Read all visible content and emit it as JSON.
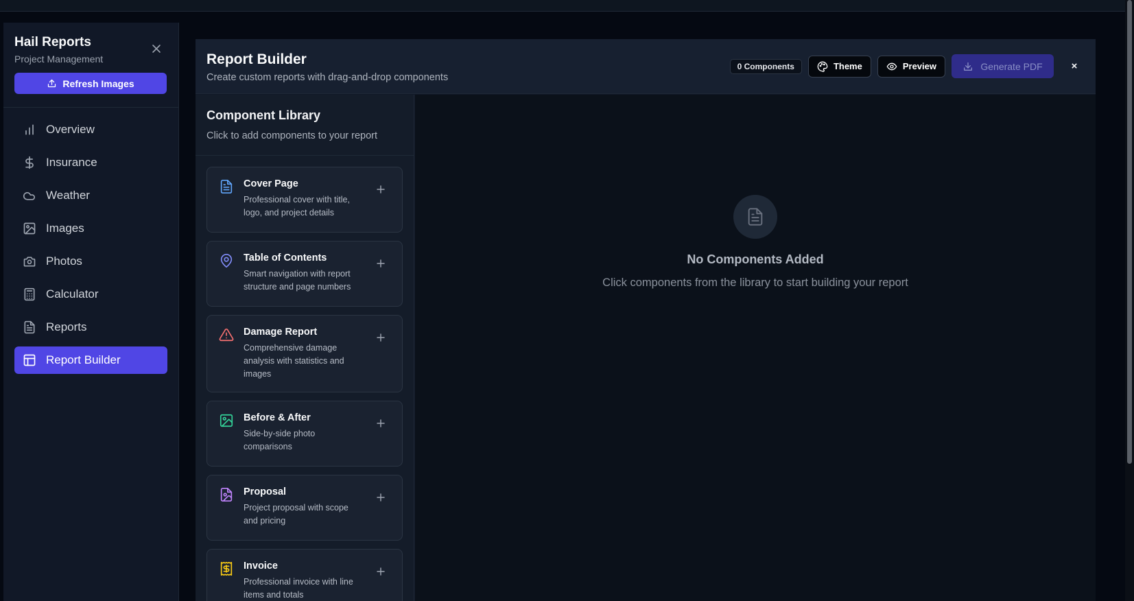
{
  "sidebar": {
    "title": "Hail Reports",
    "subtitle": "Project Management",
    "refresh_label": "Refresh Images",
    "items": [
      {
        "label": "Overview",
        "icon": "bar-chart-icon"
      },
      {
        "label": "Insurance",
        "icon": "dollar-icon"
      },
      {
        "label": "Weather",
        "icon": "cloud-icon"
      },
      {
        "label": "Images",
        "icon": "image-icon"
      },
      {
        "label": "Photos",
        "icon": "camera-icon"
      },
      {
        "label": "Calculator",
        "icon": "calculator-icon"
      },
      {
        "label": "Reports",
        "icon": "file-text-icon"
      },
      {
        "label": "Report Builder",
        "icon": "layout-icon",
        "active": true
      }
    ]
  },
  "header": {
    "title": "Report Builder",
    "subtitle": "Create custom reports with drag-and-drop components",
    "component_count": "0 Components",
    "theme_label": "Theme",
    "preview_label": "Preview",
    "generate_label": "Generate PDF",
    "close_glyph": "×"
  },
  "library": {
    "title": "Component Library",
    "subtitle": "Click to add components to your report",
    "components": [
      {
        "title": "Cover Page",
        "desc": "Professional cover with title, logo, and project details",
        "icon": "file-text-icon",
        "color": "#60a5fa"
      },
      {
        "title": "Table of Contents",
        "desc": "Smart navigation with report structure and page numbers",
        "icon": "map-pin-icon",
        "color": "#818cf8"
      },
      {
        "title": "Damage Report",
        "desc": "Comprehensive damage analysis with statistics and images",
        "icon": "alert-triangle-icon",
        "color": "#f87171"
      },
      {
        "title": "Before & After",
        "desc": "Side-by-side photo comparisons",
        "icon": "image-icon",
        "color": "#34d399"
      },
      {
        "title": "Proposal",
        "desc": "Project proposal with scope and pricing",
        "icon": "file-image-icon",
        "color": "#c084fc"
      },
      {
        "title": "Invoice",
        "desc": "Professional invoice with line items and totals",
        "icon": "receipt-icon",
        "color": "#facc15"
      }
    ]
  },
  "canvas": {
    "empty_title": "No Components Added",
    "empty_subtitle": "Click components from the library to start building your report"
  }
}
